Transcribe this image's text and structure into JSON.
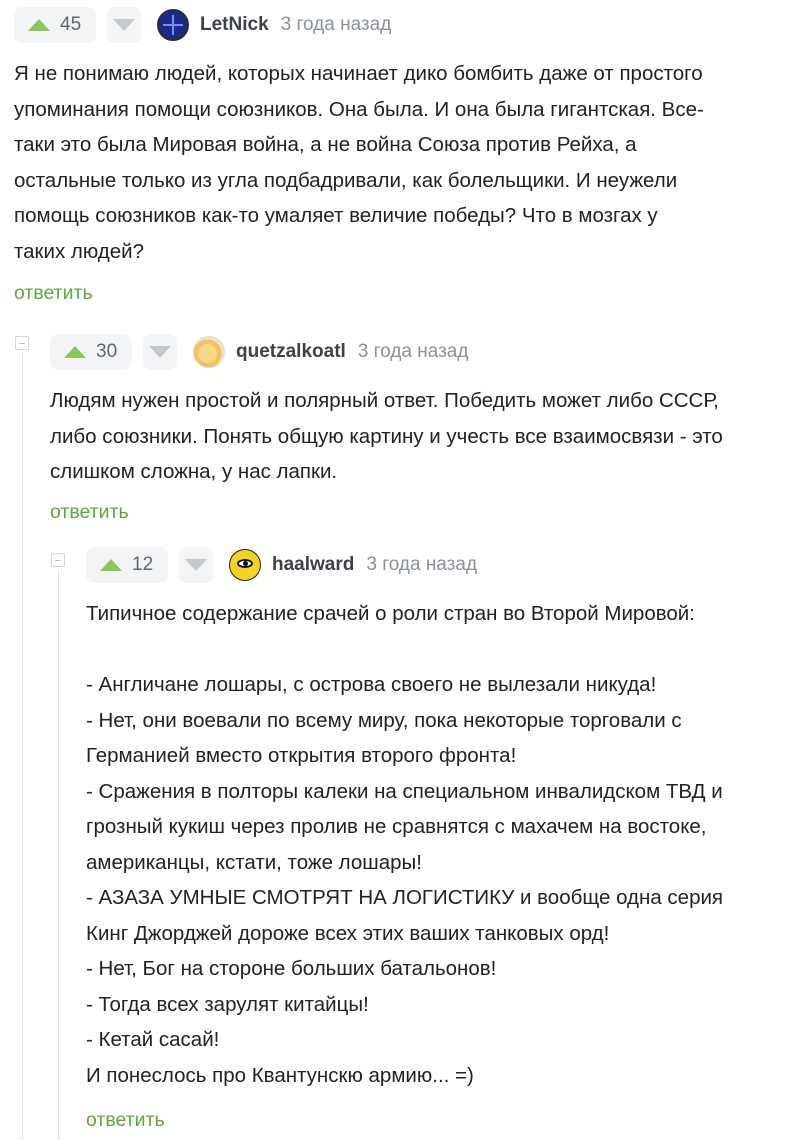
{
  "comments": [
    {
      "votes": "45",
      "author": "LetNick",
      "time": "3 года назад",
      "text": "Я не понимаю людей, которых начинает дико бомбить даже от простого\nупоминания помощи союзников. Она была. И она была гигантская. Все-\nтаки это была Мировая война, а не война Союза против Рейха, а\nостальные только из угла подбадривали, как болельщики. И неужели\nпомощь союзников как-то умаляет величие победы? Что в мозгах у\nтаких людей?",
      "reply_label": "ответить",
      "avatar_icon": "globe-avatar-icon"
    },
    {
      "votes": "30",
      "author": "quetzalkoatl",
      "time": "3 года назад",
      "text": "Людям нужен простой и полярный ответ. Победить может либо СССР,\nлибо союзники. Понять общую картину и учесть все взаимосвязи - это\nслишком сложна, у нас лапки.",
      "reply_label": "ответить",
      "avatar_icon": "orange-avatar-icon"
    },
    {
      "votes": "12",
      "author": "haalward",
      "time": "3 года назад",
      "text": "Типичное содержание срачей о роли стран во Второй Мировой:\n\n- Англичане лошары, с острова своего не вылезали никуда!\n- Нет, они воевали по всему миру, пока некоторые торговали с\nГерманией вместо открытия второго фронта!\n- Сражения в полторы калеки на специальном инвалидском ТВД и\nгрозный кукиш через пролив не сравнятся с махачем на востоке,\nамериканцы, кстати, тоже лошары!\n- АЗАЗА УМНЫЕ СМОТРЯТ НА ЛОГИСТИКУ и вообще одна серия\nКинг Джорджей дороже всех этих ваших танковых орд!\n- Нет, Бог на стороне больших батальонов!\n- Тогда всех зарулят китайцы!\n- Кетай сасай!\nИ понеслось про Квантунскю армию... =)",
      "reply_label": "ответить",
      "avatar_icon": "eye-avatar-icon"
    }
  ],
  "colors": {
    "upvote": "#8ac858",
    "reply": "#5ea83f",
    "vote_bg": "#f3f4f5"
  }
}
